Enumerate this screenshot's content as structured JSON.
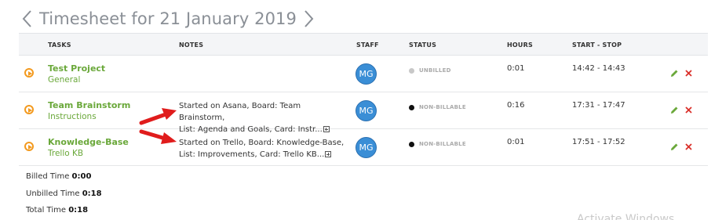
{
  "header": {
    "title": "Timesheet for 21 January 2019",
    "prev_icon": "chevron-left-icon",
    "next_icon": "chevron-right-icon"
  },
  "columns": [
    "TASKS",
    "NOTES",
    "STAFF",
    "STATUS",
    "HOURS",
    "START - STOP"
  ],
  "rows": [
    {
      "task": "Test Project",
      "subtask": "General",
      "notes_line1": "",
      "notes_line2": "",
      "staff": "MG",
      "status": "UNBILLED",
      "status_color": "#c8c8c8",
      "hours": "0:01",
      "start_stop": "14:42 - 14:43"
    },
    {
      "task": "Team Brainstorm",
      "subtask": "Instructions",
      "notes_line1": "Started on Asana, Board: Team Brainstorm,",
      "notes_line2": "List: Agenda and Goals, Card: Instr...",
      "staff": "MG",
      "status": "NON-BILLABLE",
      "status_color": "#111111",
      "hours": "0:16",
      "start_stop": "17:31 - 17:47"
    },
    {
      "task": "Knowledge-Base",
      "subtask": "Trello KB",
      "notes_line1": "Started on Trello, Board: Knowledge-Base,",
      "notes_line2": "List: Improvements, Card: Trello KB...",
      "staff": "MG",
      "status": "NON-BILLABLE",
      "status_color": "#111111",
      "hours": "0:01",
      "start_stop": "17:51 - 17:52"
    }
  ],
  "totals": {
    "billed_label": "Billed Time",
    "billed_value": "0:00",
    "unbilled_label": "Unbilled Time",
    "unbilled_value": "0:18",
    "total_label": "Total Time",
    "total_value": "0:18"
  },
  "colors": {
    "accent_green": "#6aa83a",
    "play_orange": "#f39a1f",
    "avatar_blue": "#3a8ed6",
    "delete_red": "#d9302a",
    "annotation_arrow": "#e01c1c"
  },
  "watermark": "Activate Windows"
}
